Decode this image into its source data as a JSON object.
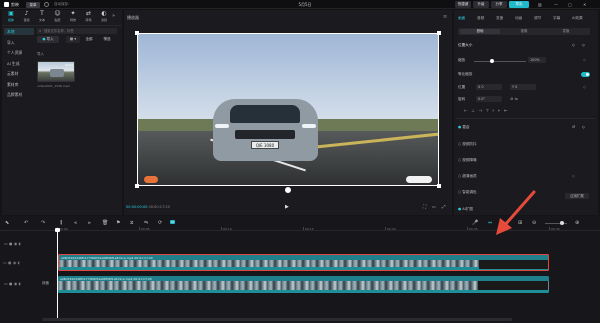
{
  "titlebar": {
    "app_name": "剪映",
    "menu_label": "菜单",
    "autosave": "自动保存：",
    "window_title": "5月5日",
    "buttons": [
      "快捷键",
      "升级",
      "分享"
    ],
    "export_label": "导出"
  },
  "toolbar": {
    "tools": [
      {
        "label": "媒体",
        "icon": "▣"
      },
      {
        "label": "音频",
        "icon": "♪"
      },
      {
        "label": "文本",
        "icon": "T"
      },
      {
        "label": "贴纸",
        "icon": "☺"
      },
      {
        "label": "特效",
        "icon": "✦"
      },
      {
        "label": "转场",
        "icon": "⇄"
      },
      {
        "label": "滤镜",
        "icon": "◐"
      }
    ],
    "more_icon": "»"
  },
  "sidebar": {
    "items": [
      "本地",
      "导入",
      "个人资源",
      "AI 生成",
      "云素材",
      "素材库",
      "品牌素材"
    ]
  },
  "media": {
    "search_placeholder": "搜索文件名称、标签",
    "import_label": "导入",
    "sort_label": "全部",
    "filter_label": "筛选",
    "section_label": "导入",
    "thumb_duration": "00:04",
    "thumb_name": "video0001_1546.mp4"
  },
  "player": {
    "title": "播放器",
    "time_current": "00:00:00:00",
    "time_total": "00:00:17:20",
    "plate_text": "QIE 3080"
  },
  "properties": {
    "tabs": [
      "画面",
      "音频",
      "变速",
      "动画",
      "调节",
      "字幕",
      "AI效果"
    ],
    "subtabs": [
      "基础",
      "抠像",
      "蒙版"
    ],
    "section_title": "位置大小",
    "rows": [
      {
        "label": "缩放",
        "value": "100%"
      },
      {
        "label": "等比缩放"
      },
      {
        "label": "位置",
        "x": "0",
        "y": "0"
      },
      {
        "label": "旋转",
        "value": "0.0°"
      }
    ],
    "blend": "混合",
    "stabilize": "视频防抖",
    "denoise": "视频降噪",
    "enhance": "超清画质",
    "color": "智能调色",
    "ai_fill": "AI扩图",
    "ai_fill_btn": "应用扩展"
  },
  "timeline": {
    "ruler": [
      "00:00",
      "00:05",
      "00:10",
      "00:15",
      "00:20",
      "00:25",
      "00:30",
      "00:35",
      "00:40"
    ],
    "track1_caption": "a08d792d2d6f1177000fd4e98f46f1e5d1ca.mp4  00:01:17:20",
    "track2_caption": "a08d792d2d6f1177000fd4e98f46f1e5d1ca.mp4  00:01:17:20",
    "track2_label": "封面"
  },
  "colors": {
    "accent": "#1fb9c9",
    "selection": "#e0473c",
    "arrow": "#e64a3b"
  }
}
